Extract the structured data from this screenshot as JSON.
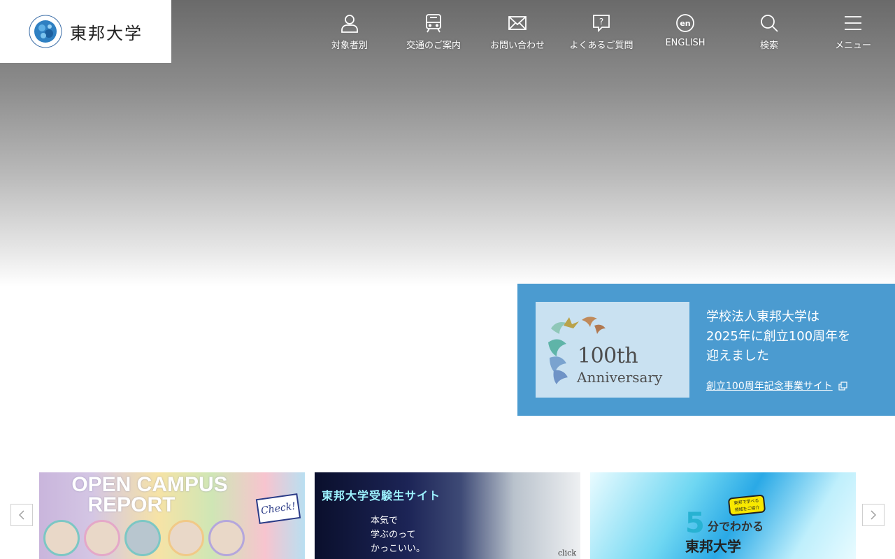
{
  "header": {
    "logo_text": "東邦大学",
    "nav": [
      {
        "icon": "person-icon",
        "label": "対象者別"
      },
      {
        "icon": "train-icon",
        "label": "交通のご案内"
      },
      {
        "icon": "mail-icon",
        "label": "お問い合わせ"
      },
      {
        "icon": "question-bubble-icon",
        "label": "よくあるご質問"
      },
      {
        "icon": "en-language-icon",
        "label": "ENGLISH"
      },
      {
        "icon": "search-icon",
        "label": "検索"
      },
      {
        "icon": "hamburger-menu-icon",
        "label": "メニュー"
      }
    ]
  },
  "anniversary": {
    "logo_number": "100th",
    "logo_word": "Anniversary",
    "heading_lines": [
      "学校法人東邦大学は",
      "2025年に創立100周年を",
      "迎えました"
    ],
    "link_label": "創立100周年記念事業サイト",
    "bg_color": "#4b9bd0"
  },
  "banners": [
    {
      "title_line1": "OPEN CAMPUS",
      "title_line2": "REPORT",
      "badge": "Check!"
    },
    {
      "title": "東邦大学受験生サイト",
      "copy_line1": "本気で",
      "copy_line2": "学ぶのって",
      "copy_line3": "かっこいい。",
      "corner": "click"
    },
    {
      "number": "5",
      "suffix": "分でわかる",
      "name": "東邦大学",
      "tag_line1": "東邦で学べる",
      "tag_line2": "領域をご紹介"
    }
  ],
  "carousel": {
    "prev_icon": "chevron-left-icon",
    "next_icon": "chevron-right-icon"
  }
}
